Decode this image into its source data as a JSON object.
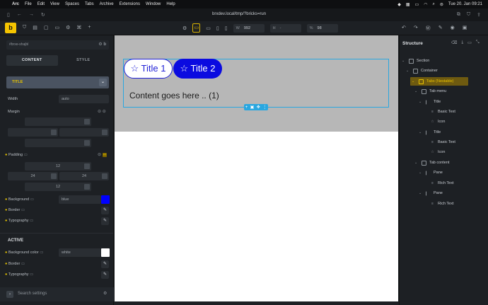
{
  "menubar": {
    "app": "Arc",
    "items": [
      "File",
      "Edit",
      "View",
      "Spaces",
      "Tabs",
      "Archive",
      "Extensions",
      "Window",
      "Help"
    ],
    "datetime": "Tue 20. Jan  09:21"
  },
  "browser": {
    "url": "brxdev.local/tmp/?bricks=run"
  },
  "toolbar": {
    "logo": "b",
    "width_label": "W",
    "width_value": "992",
    "height_label": "H",
    "height_value": "-",
    "zoom_label": "%",
    "zoom_value": "98"
  },
  "left_panel": {
    "selector": "#brxe-shajbl",
    "selector_btn": "b",
    "tabs": [
      "CONTENT",
      "STYLE"
    ],
    "section": "TITLE",
    "width_label": "Width",
    "width_value": "auto",
    "margin_label": "Margin",
    "padding_label": "Padding",
    "padding_top": "12",
    "padding_left": "24",
    "padding_right": "24",
    "padding_bottom": "12",
    "background_label": "Background",
    "background_value": "blue",
    "background_color": "#0000ff",
    "border_label": "Border",
    "typography_label": "Typography",
    "active_heading": "ACTIVE",
    "active_bg_label": "Background color",
    "active_bg_value": "white",
    "active_bg_color": "#ffffff",
    "active_border_label": "Border",
    "active_typography_label": "Typography",
    "search_placeholder": "Search settings"
  },
  "canvas": {
    "tab1": "☆ Title 1",
    "tab2": "☆ Title 2",
    "content": "Content goes here .. (1)"
  },
  "structure": {
    "title": "Structure",
    "nodes": [
      {
        "label": "Section",
        "level": 0
      },
      {
        "label": "Container",
        "level": 1
      },
      {
        "label": "Tabs (Nestable)",
        "level": 2,
        "highlight": true
      },
      {
        "label": "Tab menu",
        "level": 3
      },
      {
        "label": "Title",
        "level": 4
      },
      {
        "label": "Basic Text",
        "level": 5
      },
      {
        "label": "Icon",
        "level": 5
      },
      {
        "label": "Title",
        "level": 4
      },
      {
        "label": "Basic Text",
        "level": 5
      },
      {
        "label": "Icon",
        "level": 5
      },
      {
        "label": "Tab content",
        "level": 3
      },
      {
        "label": "Pane",
        "level": 4
      },
      {
        "label": "Rich Text",
        "level": 5
      },
      {
        "label": "Pane",
        "level": 4
      },
      {
        "label": "Rich Text",
        "level": 5
      }
    ]
  }
}
